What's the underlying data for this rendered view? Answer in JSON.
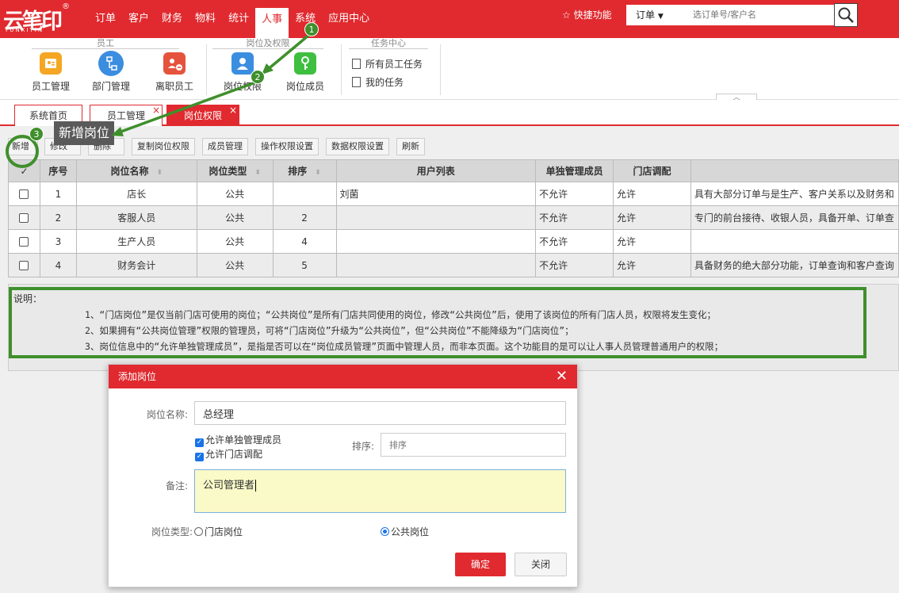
{
  "header": {
    "logo": "云笔印",
    "logo_sup": "®",
    "logo_sub": "YUNXIYIN",
    "nav": [
      "订单",
      "客户",
      "财务",
      "物料",
      "统计",
      "人事",
      "系统",
      "应用中心"
    ],
    "active_nav": "人事",
    "quick_func": "快捷功能",
    "order_select": "订单",
    "search_placeholder": "选订单号/客户名",
    "brand_color": "#e02a2f"
  },
  "ribbon": {
    "group_staff": "员工",
    "group_post": "岗位及权限",
    "group_task": "任务中心",
    "items": {
      "staff_mgmt": "员工管理",
      "dept_mgmt": "部门管理",
      "resigned": "离职员工",
      "post_perm": "岗位权限",
      "post_members": "岗位成员"
    },
    "tasks": [
      "所有员工任务",
      "我的任务"
    ]
  },
  "tabs": {
    "home": "系统首页",
    "staff": "员工管理",
    "post": "岗位权限"
  },
  "annotations": {
    "step1": "1",
    "step2": "2",
    "step3": "3",
    "tooltip": "新增岗位",
    "highlight_color": "#3f8f2c"
  },
  "toolbar": {
    "add": "新增",
    "edit": "修改",
    "delete": "删除",
    "copy_perm": "复制岗位权限",
    "members": "成员管理",
    "op_perm": "操作权限设置",
    "data_perm": "数据权限设置",
    "refresh": "刷新"
  },
  "table": {
    "headers": {
      "no": "序号",
      "name": "岗位名称",
      "type": "岗位类型",
      "order": "排序",
      "users": "用户列表",
      "separate": "单独管理成员",
      "store": "门店调配"
    },
    "rows": [
      {
        "no": "1",
        "name": "店长",
        "type": "公共",
        "order": "",
        "users": "刘菌",
        "separate": "不允许",
        "store": "允许",
        "remark": "具有大部分订单与是生产、客户关系以及财务和"
      },
      {
        "no": "2",
        "name": "客服人员",
        "type": "公共",
        "order": "2",
        "users": "",
        "separate": "不允许",
        "store": "允许",
        "remark": "专门的前台接待、收银人员，具备开单、订单查"
      },
      {
        "no": "3",
        "name": "生产人员",
        "type": "公共",
        "order": "4",
        "users": "",
        "separate": "不允许",
        "store": "允许",
        "remark": ""
      },
      {
        "no": "4",
        "name": "财务会计",
        "type": "公共",
        "order": "5",
        "users": "",
        "separate": "不允许",
        "store": "允许",
        "remark": "具备财务的绝大部分功能，订单查询和客户查询"
      }
    ]
  },
  "notes": {
    "title": "说明：",
    "lines": [
      "1、“门店岗位”是仅当前门店可使用的岗位；“公共岗位”是所有门店共同使用的岗位，修改“公共岗位”后，使用了该岗位的所有门店人员，权限将发生变化；",
      "2、如果拥有“公共岗位管理”权限的管理员，可将“门店岗位”升级为“公共岗位”，但“公共岗位”不能降级为“门店岗位”；",
      "3、岗位信息中的“允许单独管理成员”，是指是否可以在“岗位成员管理”页面中管理人员，而非本页面。这个功能目的是可以让人事人员管理普通用户的权限；"
    ]
  },
  "dialog": {
    "title": "添加岗位",
    "name_label": "岗位名称:",
    "name_value": "总经理",
    "chk_separate": "允许单独管理成员",
    "chk_store": "允许门店调配",
    "order_label": "排序:",
    "order_placeholder": "排序",
    "remark_label": "备注:",
    "remark_value": "公司管理者",
    "type_label": "岗位类型:",
    "type_store": "门店岗位",
    "type_public": "公共岗位",
    "selected_type": "公共岗位",
    "ok": "确定",
    "close": "关闭"
  }
}
